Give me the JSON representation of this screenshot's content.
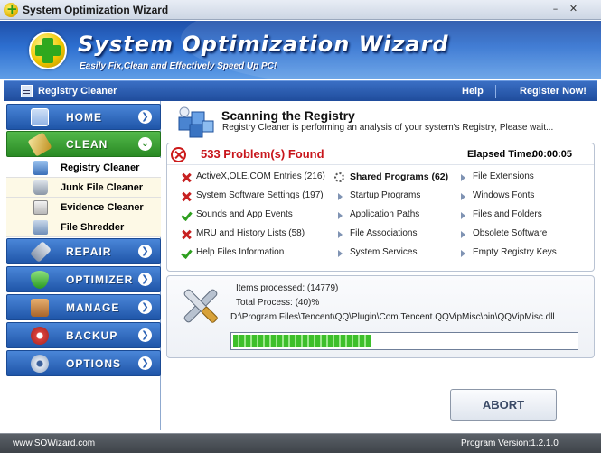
{
  "window": {
    "title": "System Optimization Wizard"
  },
  "banner": {
    "brand": "System Optimization Wizard",
    "tagline": "Easily Fix,Clean and Effectively Speed Up PC!"
  },
  "navbar": {
    "crumb": "Registry Cleaner",
    "help": "Help",
    "register": "Register Now!"
  },
  "sidebar": {
    "home": "HOME",
    "clean": "CLEAN",
    "subitems": [
      "Registry Cleaner",
      "Junk File Cleaner",
      "Evidence Cleaner",
      "File Shredder"
    ],
    "repair": "REPAIR",
    "optimizer": "OPTIMIZER",
    "manage": "MANAGE",
    "backup": "BACKUP",
    "options": "OPTIONS"
  },
  "scan": {
    "title": "Scanning the Registry",
    "subtitle": "Registry Cleaner is performing an analysis of your system's Registry, Please wait..."
  },
  "results": {
    "problems": "533 Problem(s) Found",
    "elapsed_label": "Elapsed Time:",
    "elapsed_value": "00:00:05",
    "col1": [
      {
        "icon": "x",
        "text": "ActiveX,OLE,COM Entries (216)"
      },
      {
        "icon": "x",
        "text": "System Software Settings (197)"
      },
      {
        "icon": "ok",
        "text": "Sounds and App Events"
      },
      {
        "icon": "x",
        "text": "MRU and History Lists (58)"
      },
      {
        "icon": "ok",
        "text": "Help Files Information"
      }
    ],
    "col2": [
      {
        "icon": "spin",
        "text": "Shared Programs (62)"
      },
      {
        "icon": "arrow",
        "text": "Startup Programs"
      },
      {
        "icon": "arrow",
        "text": "Application Paths"
      },
      {
        "icon": "arrow",
        "text": "File Associations"
      },
      {
        "icon": "arrow",
        "text": "System Services"
      }
    ],
    "col3": [
      {
        "icon": "arrow",
        "text": "File Extensions"
      },
      {
        "icon": "arrow",
        "text": "Windows Fonts"
      },
      {
        "icon": "arrow",
        "text": "Files and Folders"
      },
      {
        "icon": "arrow",
        "text": "Obsolete Software"
      },
      {
        "icon": "arrow",
        "text": "Empty Registry Keys"
      }
    ]
  },
  "progress": {
    "items": "Items processed: (14779)",
    "total": "Total Process: (40)%",
    "path": "D:\\Program Files\\Tencent\\QQ\\Plugin\\Com.Tencent.QQVipMisc\\bin\\QQVipMisc.dll",
    "fraction": 0.4
  },
  "abort_label": "ABORT",
  "status": {
    "site": "www.SOWizard.com",
    "version": "Program Version:1.2.1.0"
  },
  "colors": {
    "accent": "#1f55a8",
    "clean_green": "#2a8a24",
    "problem_red": "#c8151b"
  }
}
